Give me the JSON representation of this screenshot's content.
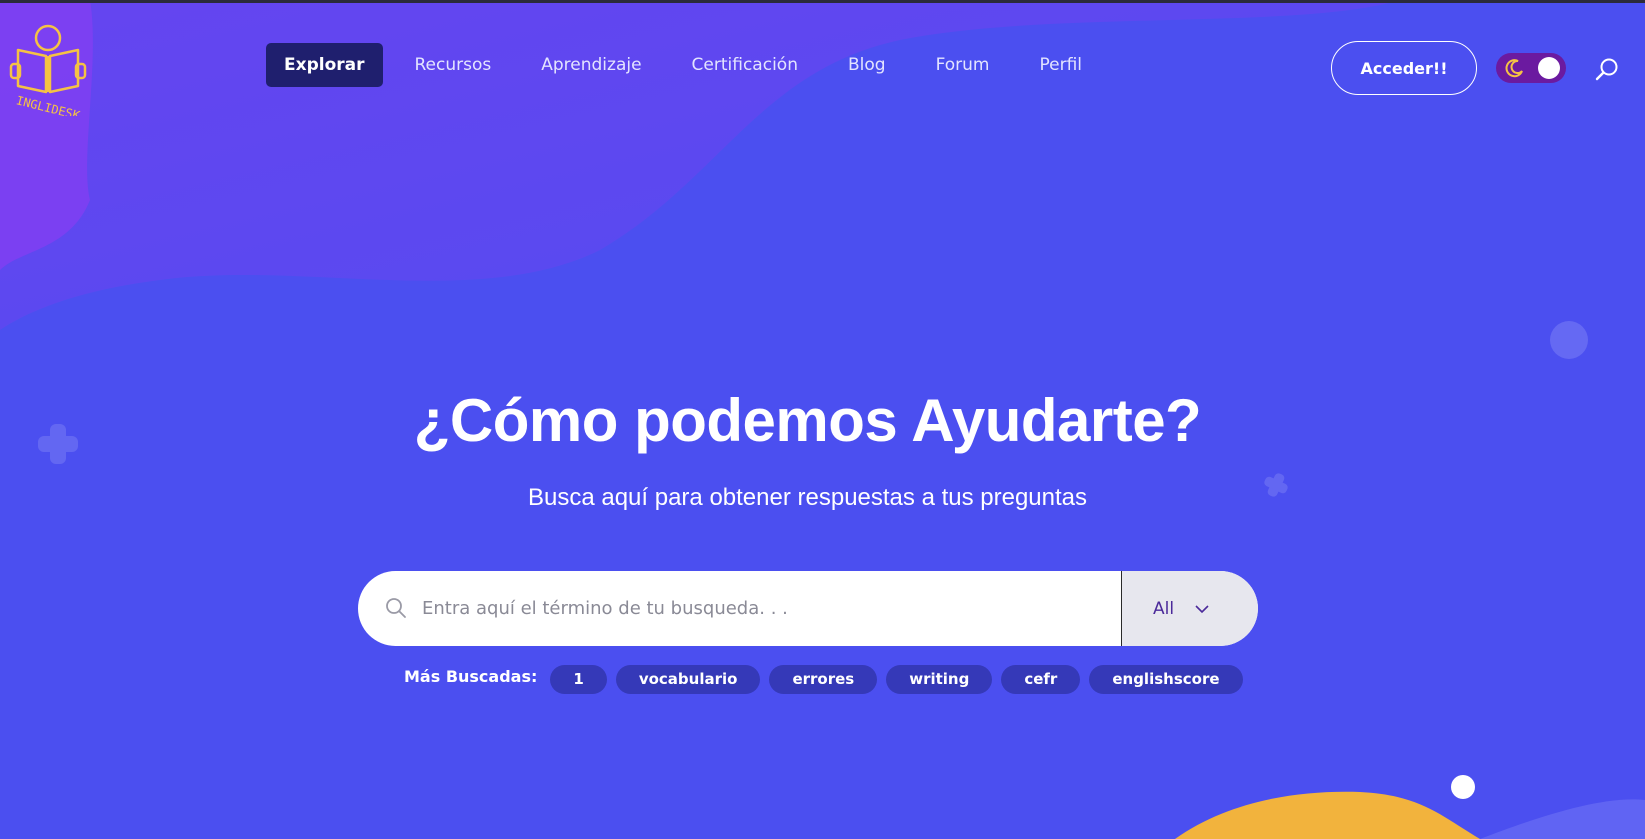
{
  "brand": {
    "logo_text": "INGLIDESK"
  },
  "nav": {
    "items": [
      {
        "label": "Explorar",
        "active": true
      },
      {
        "label": "Recursos"
      },
      {
        "label": "Aprendizaje"
      },
      {
        "label": "Certificación"
      },
      {
        "label": "Blog"
      },
      {
        "label": "Forum"
      },
      {
        "label": "Perfil"
      }
    ],
    "login_label": "Acceder!!",
    "theme_toggle": {
      "mode": "dark",
      "icon": "moon-icon"
    },
    "search_icon": "search-icon"
  },
  "hero": {
    "title": "¿Cómo podemos Ayudarte?",
    "subtitle": "Busca aquí para obtener respuestas a tus preguntas"
  },
  "search": {
    "placeholder": "Entra aquí el término de tu busqueda. . .",
    "value": "",
    "category_selected": "All"
  },
  "popular": {
    "label": "Más Buscadas:",
    "tags": [
      "1",
      "vocabulario",
      "errores",
      "writing",
      "cefr",
      "englishscore"
    ]
  },
  "colors": {
    "background": "#4b4ff0",
    "nav_active": "#1f1f6e",
    "tag": "#3539b8",
    "accent_yellow": "#f2b33d",
    "toggle": "#6b1aa0"
  }
}
